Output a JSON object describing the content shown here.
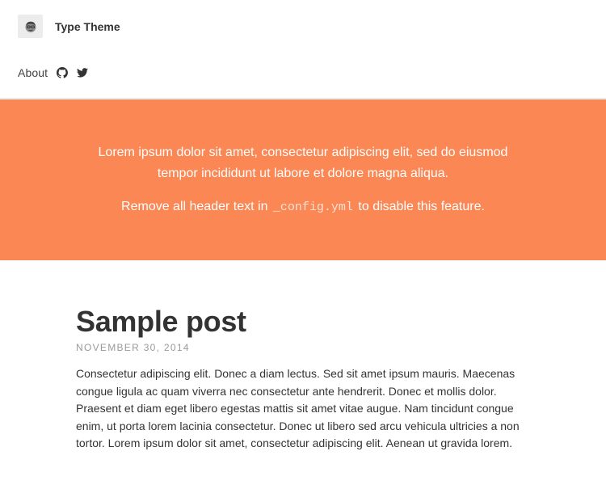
{
  "header": {
    "site_title": "Type Theme",
    "avatar_icon": "avatar-icon"
  },
  "nav": {
    "about_label": "About",
    "github_icon": "github-icon",
    "twitter_icon": "twitter-icon"
  },
  "banner": {
    "background_color": "#fa8754",
    "intro": "Lorem ipsum dolor sit amet, consectetur adipiscing elit, sed do eiusmod tempor incididunt ut labore et dolore magna aliqua.",
    "config_prefix": "Remove all header text in",
    "config_file": "_config.yml",
    "config_suffix": "to disable this feature."
  },
  "post": {
    "title": "Sample post",
    "date": "NOVEMBER 30, 2014",
    "excerpt": "Consectetur adipiscing elit. Donec a diam lectus. Sed sit amet ipsum mauris. Maecenas congue ligula ac quam viverra nec consectetur ante hendrerit. Donec et mollis dolor. Praesent et diam eget libero egestas mattis sit amet vitae augue. Nam tincidunt congue enim, ut porta lorem lacinia consectetur. Donec ut libero sed arcu vehicula ultricies a non tortor. Lorem ipsum dolor sit amet, consectetur adipiscing elit. Aenean ut gravida lorem."
  }
}
